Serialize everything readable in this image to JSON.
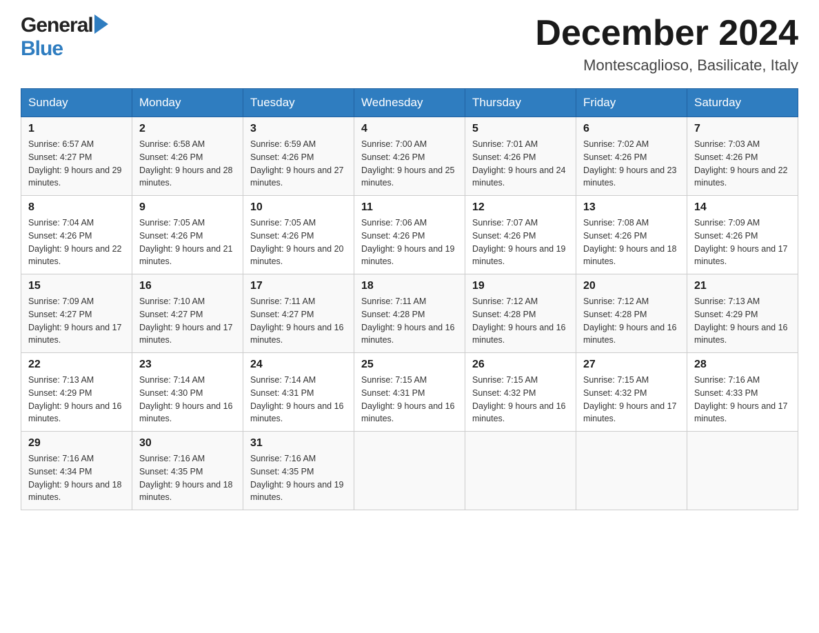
{
  "header": {
    "logo_general": "General",
    "logo_blue": "Blue",
    "month_title": "December 2024",
    "location": "Montescaglioso, Basilicate, Italy"
  },
  "days_of_week": [
    "Sunday",
    "Monday",
    "Tuesday",
    "Wednesday",
    "Thursday",
    "Friday",
    "Saturday"
  ],
  "weeks": [
    [
      {
        "day": "1",
        "sunrise": "Sunrise: 6:57 AM",
        "sunset": "Sunset: 4:27 PM",
        "daylight": "Daylight: 9 hours and 29 minutes."
      },
      {
        "day": "2",
        "sunrise": "Sunrise: 6:58 AM",
        "sunset": "Sunset: 4:26 PM",
        "daylight": "Daylight: 9 hours and 28 minutes."
      },
      {
        "day": "3",
        "sunrise": "Sunrise: 6:59 AM",
        "sunset": "Sunset: 4:26 PM",
        "daylight": "Daylight: 9 hours and 27 minutes."
      },
      {
        "day": "4",
        "sunrise": "Sunrise: 7:00 AM",
        "sunset": "Sunset: 4:26 PM",
        "daylight": "Daylight: 9 hours and 25 minutes."
      },
      {
        "day": "5",
        "sunrise": "Sunrise: 7:01 AM",
        "sunset": "Sunset: 4:26 PM",
        "daylight": "Daylight: 9 hours and 24 minutes."
      },
      {
        "day": "6",
        "sunrise": "Sunrise: 7:02 AM",
        "sunset": "Sunset: 4:26 PM",
        "daylight": "Daylight: 9 hours and 23 minutes."
      },
      {
        "day": "7",
        "sunrise": "Sunrise: 7:03 AM",
        "sunset": "Sunset: 4:26 PM",
        "daylight": "Daylight: 9 hours and 22 minutes."
      }
    ],
    [
      {
        "day": "8",
        "sunrise": "Sunrise: 7:04 AM",
        "sunset": "Sunset: 4:26 PM",
        "daylight": "Daylight: 9 hours and 22 minutes."
      },
      {
        "day": "9",
        "sunrise": "Sunrise: 7:05 AM",
        "sunset": "Sunset: 4:26 PM",
        "daylight": "Daylight: 9 hours and 21 minutes."
      },
      {
        "day": "10",
        "sunrise": "Sunrise: 7:05 AM",
        "sunset": "Sunset: 4:26 PM",
        "daylight": "Daylight: 9 hours and 20 minutes."
      },
      {
        "day": "11",
        "sunrise": "Sunrise: 7:06 AM",
        "sunset": "Sunset: 4:26 PM",
        "daylight": "Daylight: 9 hours and 19 minutes."
      },
      {
        "day": "12",
        "sunrise": "Sunrise: 7:07 AM",
        "sunset": "Sunset: 4:26 PM",
        "daylight": "Daylight: 9 hours and 19 minutes."
      },
      {
        "day": "13",
        "sunrise": "Sunrise: 7:08 AM",
        "sunset": "Sunset: 4:26 PM",
        "daylight": "Daylight: 9 hours and 18 minutes."
      },
      {
        "day": "14",
        "sunrise": "Sunrise: 7:09 AM",
        "sunset": "Sunset: 4:26 PM",
        "daylight": "Daylight: 9 hours and 17 minutes."
      }
    ],
    [
      {
        "day": "15",
        "sunrise": "Sunrise: 7:09 AM",
        "sunset": "Sunset: 4:27 PM",
        "daylight": "Daylight: 9 hours and 17 minutes."
      },
      {
        "day": "16",
        "sunrise": "Sunrise: 7:10 AM",
        "sunset": "Sunset: 4:27 PM",
        "daylight": "Daylight: 9 hours and 17 minutes."
      },
      {
        "day": "17",
        "sunrise": "Sunrise: 7:11 AM",
        "sunset": "Sunset: 4:27 PM",
        "daylight": "Daylight: 9 hours and 16 minutes."
      },
      {
        "day": "18",
        "sunrise": "Sunrise: 7:11 AM",
        "sunset": "Sunset: 4:28 PM",
        "daylight": "Daylight: 9 hours and 16 minutes."
      },
      {
        "day": "19",
        "sunrise": "Sunrise: 7:12 AM",
        "sunset": "Sunset: 4:28 PM",
        "daylight": "Daylight: 9 hours and 16 minutes."
      },
      {
        "day": "20",
        "sunrise": "Sunrise: 7:12 AM",
        "sunset": "Sunset: 4:28 PM",
        "daylight": "Daylight: 9 hours and 16 minutes."
      },
      {
        "day": "21",
        "sunrise": "Sunrise: 7:13 AM",
        "sunset": "Sunset: 4:29 PM",
        "daylight": "Daylight: 9 hours and 16 minutes."
      }
    ],
    [
      {
        "day": "22",
        "sunrise": "Sunrise: 7:13 AM",
        "sunset": "Sunset: 4:29 PM",
        "daylight": "Daylight: 9 hours and 16 minutes."
      },
      {
        "day": "23",
        "sunrise": "Sunrise: 7:14 AM",
        "sunset": "Sunset: 4:30 PM",
        "daylight": "Daylight: 9 hours and 16 minutes."
      },
      {
        "day": "24",
        "sunrise": "Sunrise: 7:14 AM",
        "sunset": "Sunset: 4:31 PM",
        "daylight": "Daylight: 9 hours and 16 minutes."
      },
      {
        "day": "25",
        "sunrise": "Sunrise: 7:15 AM",
        "sunset": "Sunset: 4:31 PM",
        "daylight": "Daylight: 9 hours and 16 minutes."
      },
      {
        "day": "26",
        "sunrise": "Sunrise: 7:15 AM",
        "sunset": "Sunset: 4:32 PM",
        "daylight": "Daylight: 9 hours and 16 minutes."
      },
      {
        "day": "27",
        "sunrise": "Sunrise: 7:15 AM",
        "sunset": "Sunset: 4:32 PM",
        "daylight": "Daylight: 9 hours and 17 minutes."
      },
      {
        "day": "28",
        "sunrise": "Sunrise: 7:16 AM",
        "sunset": "Sunset: 4:33 PM",
        "daylight": "Daylight: 9 hours and 17 minutes."
      }
    ],
    [
      {
        "day": "29",
        "sunrise": "Sunrise: 7:16 AM",
        "sunset": "Sunset: 4:34 PM",
        "daylight": "Daylight: 9 hours and 18 minutes."
      },
      {
        "day": "30",
        "sunrise": "Sunrise: 7:16 AM",
        "sunset": "Sunset: 4:35 PM",
        "daylight": "Daylight: 9 hours and 18 minutes."
      },
      {
        "day": "31",
        "sunrise": "Sunrise: 7:16 AM",
        "sunset": "Sunset: 4:35 PM",
        "daylight": "Daylight: 9 hours and 19 minutes."
      },
      null,
      null,
      null,
      null
    ]
  ]
}
